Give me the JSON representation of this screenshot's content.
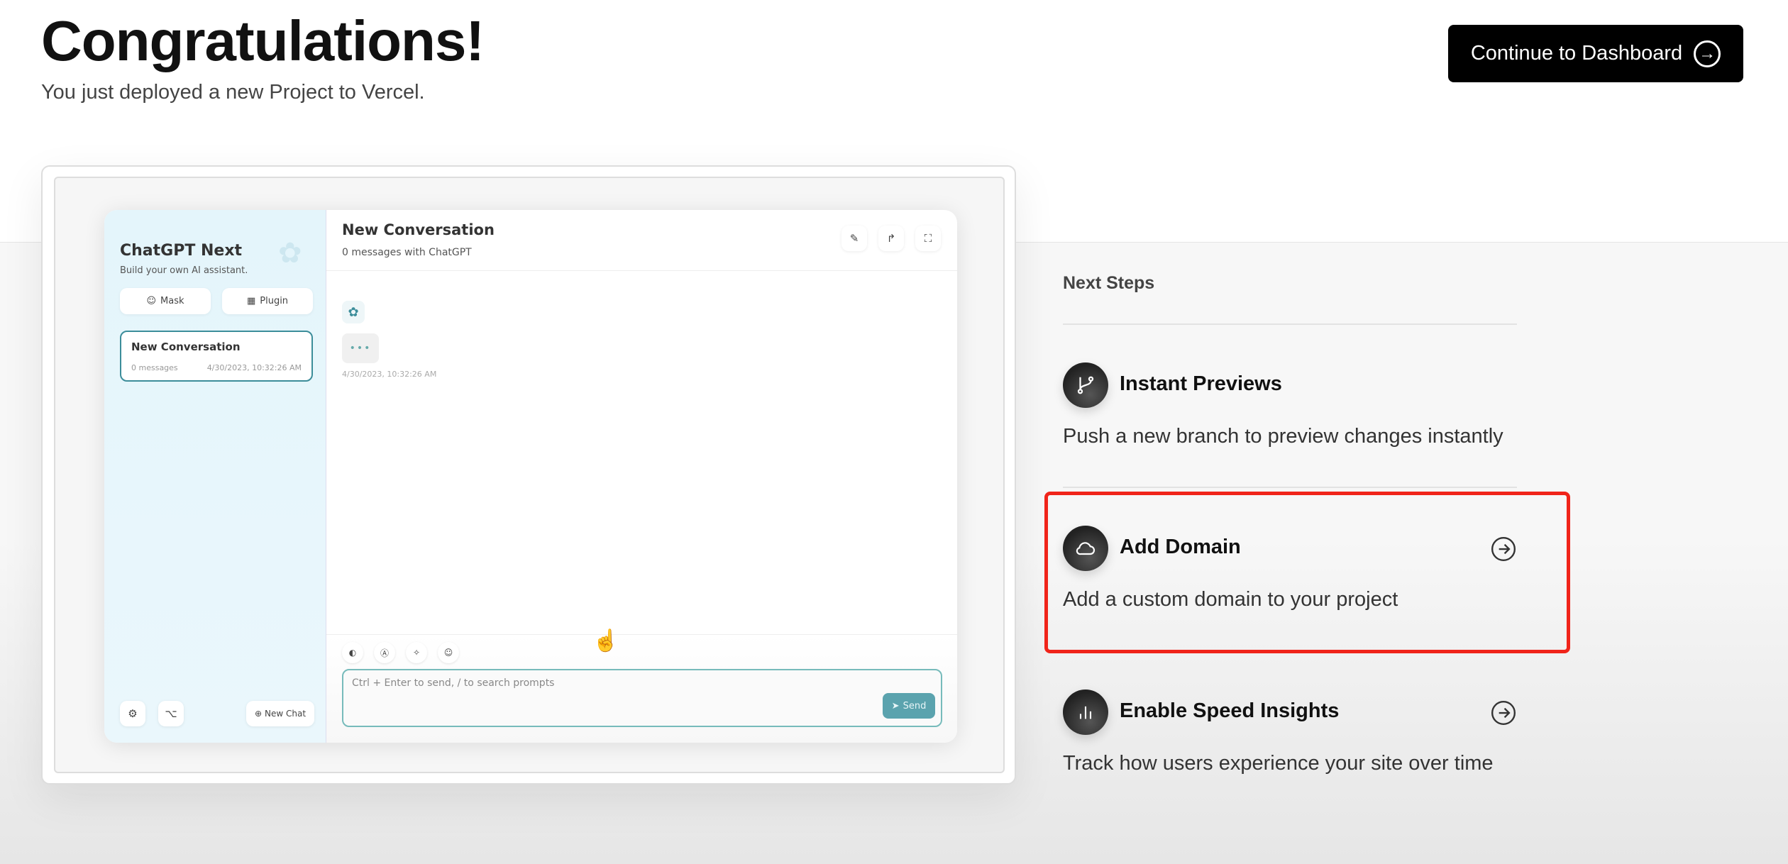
{
  "header": {
    "title": "Congratulations!",
    "subtitle": "You just deployed a new Project to Vercel.",
    "continue_label": "Continue to Dashboard"
  },
  "preview": {
    "sidebar": {
      "app_name": "ChatGPT Next",
      "tagline": "Build your own AI assistant.",
      "mask_label": "Mask",
      "plugin_label": "Plugin",
      "conversation": {
        "title": "New Conversation",
        "count": "0 messages",
        "date": "4/30/2023, 10:32:26 AM"
      },
      "new_chat_label": "New Chat"
    },
    "chat": {
      "title": "New Conversation",
      "subtitle": "0 messages with ChatGPT",
      "message_date": "4/30/2023, 10:32:26 AM",
      "typing": "•••",
      "input_placeholder": "Ctrl + Enter to send, / to search prompts",
      "send_label": "Send"
    }
  },
  "next_steps": {
    "label": "Next Steps",
    "items": [
      {
        "title": "Instant Previews",
        "description": "Push a new branch to preview changes instantly",
        "icon": "git-branch-icon"
      },
      {
        "title": "Add Domain",
        "description": "Add a custom domain to your project",
        "icon": "cloud-icon",
        "highlighted": true
      },
      {
        "title": "Enable Speed Insights",
        "description": "Track how users experience your site over time",
        "icon": "bar-chart-icon"
      }
    ]
  },
  "colors": {
    "highlight": "#f0241a",
    "accent": "#3c8d9a",
    "button": "#000000"
  }
}
